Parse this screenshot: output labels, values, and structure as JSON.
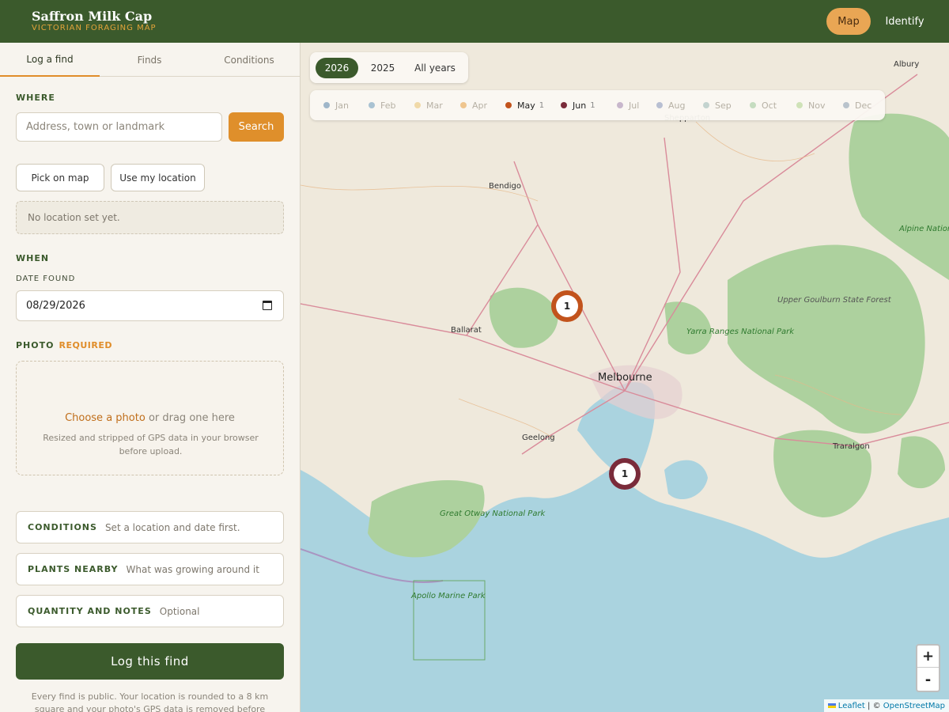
{
  "app": {
    "title": "Saffron Milk Cap",
    "subtitle": "VICTORIAN FORAGING MAP"
  },
  "nav": {
    "map": "Map",
    "identify": "Identify"
  },
  "tabs": [
    "Log a find",
    "Finds",
    "Conditions"
  ],
  "form": {
    "where_label": "WHERE",
    "address_placeholder": "Address, town or landmark",
    "search_label": "Search",
    "pick_on_map": "Pick on map",
    "use_my_location": "Use my location",
    "location_status": "No location set yet.",
    "when_label": "WHEN",
    "date_found_label": "DATE FOUND",
    "date_value": "08/29/2026",
    "photo_label": "PHOTO",
    "photo_required": "REQUIRED",
    "photo_choose": "Choose a photo",
    "photo_drag": "or drag one here",
    "photo_note": "Resized and stripped of GPS data in your browser before upload.",
    "sections": [
      {
        "title": "CONDITIONS",
        "hint": "Set a location and date first."
      },
      {
        "title": "PLANTS NEARBY",
        "hint": "What was growing around it"
      },
      {
        "title": "QUANTITY AND NOTES",
        "hint": "Optional"
      }
    ],
    "submit": "Log this find",
    "footnote": "Every find is public. Your location is rounded to a 8 km square and your photo's GPS data is removed before anything is sent."
  },
  "map": {
    "years": [
      "2026",
      "2025",
      "All years"
    ],
    "active_year": "2026",
    "months": [
      {
        "name": "Jan",
        "count": "",
        "color": "#9fb6c9",
        "active": false
      },
      {
        "name": "Feb",
        "count": "",
        "color": "#a9c2d2",
        "active": false
      },
      {
        "name": "Mar",
        "count": "",
        "color": "#f0d9a8",
        "active": false
      },
      {
        "name": "Apr",
        "count": "",
        "color": "#efc58e",
        "active": false
      },
      {
        "name": "May",
        "count": "1",
        "color": "#c2531c",
        "active": true
      },
      {
        "name": "Jun",
        "count": "1",
        "color": "#7a2b3a",
        "active": true
      },
      {
        "name": "Jul",
        "count": "",
        "color": "#c8b7cc",
        "active": false
      },
      {
        "name": "Aug",
        "count": "",
        "color": "#b8bfd2",
        "active": false
      },
      {
        "name": "Sep",
        "count": "",
        "color": "#c3d3cf",
        "active": false
      },
      {
        "name": "Oct",
        "count": "",
        "color": "#c5dcc0",
        "active": false
      },
      {
        "name": "Nov",
        "count": "",
        "color": "#cfe2b8",
        "active": false
      },
      {
        "name": "Dec",
        "count": "",
        "color": "#b9c3cc",
        "active": false
      }
    ],
    "markers": [
      {
        "count": "1",
        "color": "#c2531c"
      },
      {
        "count": "1",
        "color": "#7a2b3a"
      }
    ],
    "places": {
      "albury": "Albury",
      "bendigo": "Bendigo",
      "shepparton": "Shepparton",
      "ballarat": "Ballarat",
      "melbourne": "Melbourne",
      "geelong": "Geelong",
      "traralgon": "Traralgon",
      "alpine": "Alpine National Park",
      "goulburn": "Upper Goulburn State Forest",
      "yarra": "Yarra Ranges National Park",
      "otway": "Great Otway National Park",
      "apollo": "Apollo Marine Park"
    },
    "zoom_in": "+",
    "zoom_out": "-",
    "attribution": {
      "leaflet": "Leaflet",
      "sep": "| ©",
      "osm": "OpenStreetMap"
    }
  }
}
